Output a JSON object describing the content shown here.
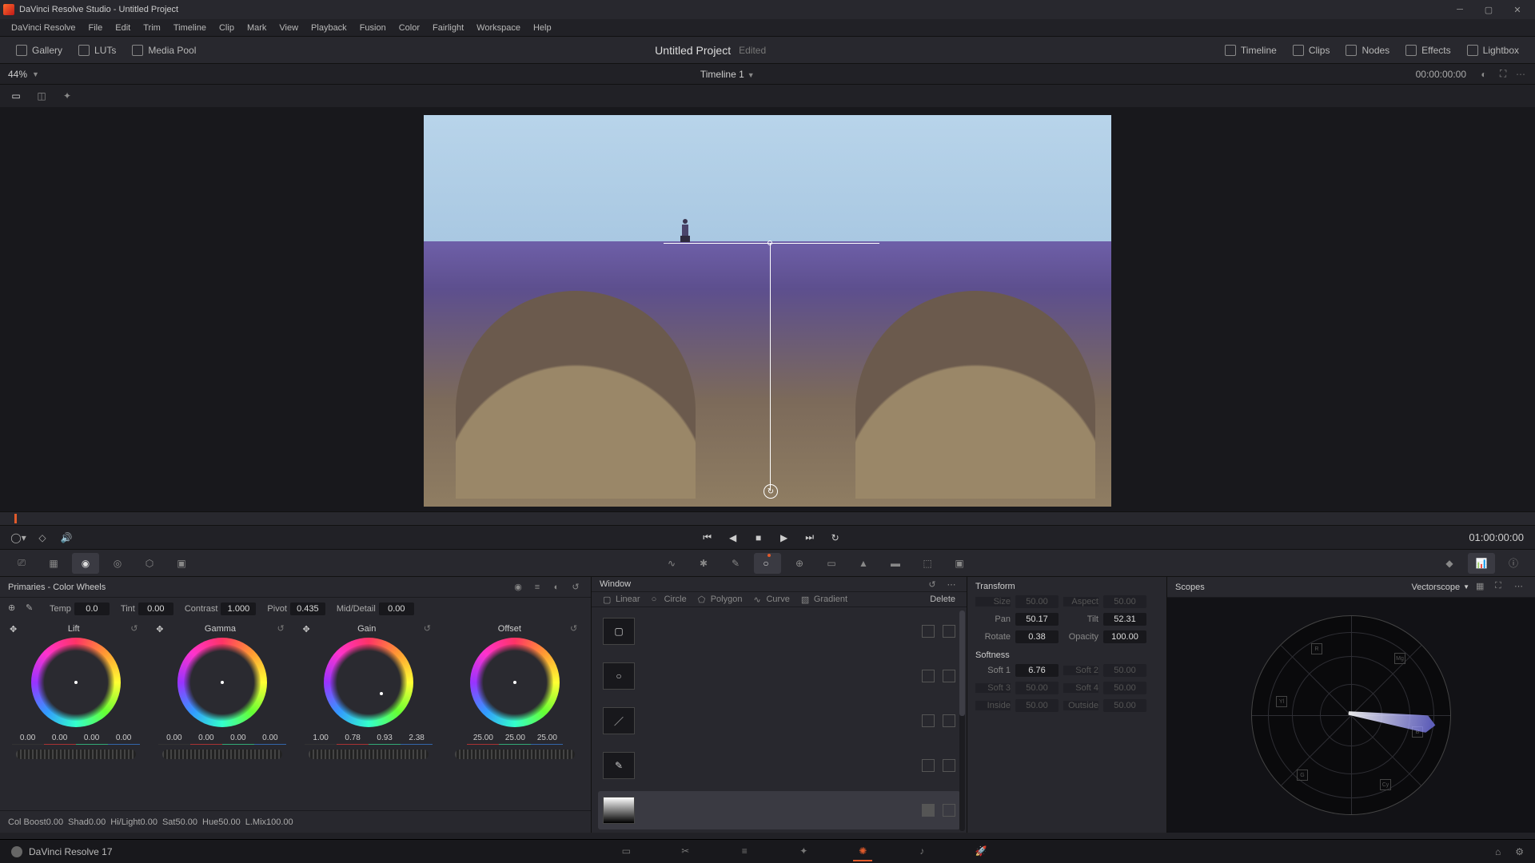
{
  "titlebar": {
    "text": "DaVinci Resolve Studio - Untitled Project"
  },
  "menu": [
    "DaVinci Resolve",
    "File",
    "Edit",
    "Trim",
    "Timeline",
    "Clip",
    "Mark",
    "View",
    "Playback",
    "Fusion",
    "Color",
    "Fairlight",
    "Workspace",
    "Help"
  ],
  "toolbar": {
    "left": [
      {
        "icon": "gallery-icon",
        "label": "Gallery"
      },
      {
        "icon": "luts-icon",
        "label": "LUTs"
      },
      {
        "icon": "media-pool-icon",
        "label": "Media Pool"
      }
    ],
    "project": "Untitled Project",
    "edited": "Edited",
    "right": [
      {
        "icon": "timeline-icon",
        "label": "Timeline"
      },
      {
        "icon": "clips-icon",
        "label": "Clips"
      },
      {
        "icon": "nodes-icon",
        "label": "Nodes"
      },
      {
        "icon": "effects-icon",
        "label": "Effects"
      },
      {
        "icon": "lightbox-icon",
        "label": "Lightbox"
      }
    ]
  },
  "secbar": {
    "zoom": "44%",
    "timeline": "Timeline 1",
    "timecode": "00:00:00:00"
  },
  "transport": {
    "timecode": "01:00:00:00"
  },
  "primaries": {
    "title": "Primaries - Color Wheels",
    "top": {
      "temp_l": "Temp",
      "temp": "0.0",
      "tint_l": "Tint",
      "tint": "0.00",
      "contrast_l": "Contrast",
      "contrast": "1.000",
      "pivot_l": "Pivot",
      "pivot": "0.435",
      "md_l": "Mid/Detail",
      "md": "0.00"
    },
    "wheels": {
      "lift": {
        "label": "Lift",
        "vals": [
          "0.00",
          "0.00",
          "0.00",
          "0.00"
        ]
      },
      "gamma": {
        "label": "Gamma",
        "vals": [
          "0.00",
          "0.00",
          "0.00",
          "0.00"
        ]
      },
      "gain": {
        "label": "Gain",
        "vals": [
          "1.00",
          "0.78",
          "0.93",
          "2.38"
        ]
      },
      "offset": {
        "label": "Offset",
        "vals": [
          "25.00",
          "25.00",
          "25.00"
        ]
      }
    },
    "bottom": {
      "cb_l": "Col Boost",
      "cb": "0.00",
      "shad_l": "Shad",
      "shad": "0.00",
      "hl_l": "Hi/Light",
      "hl": "0.00",
      "sat_l": "Sat",
      "sat": "50.00",
      "hue_l": "Hue",
      "hue": "50.00",
      "lmix_l": "L.Mix",
      "lmix": "100.00"
    }
  },
  "window": {
    "title": "Window",
    "shapes": {
      "linear": "Linear",
      "circle": "Circle",
      "polygon": "Polygon",
      "curve": "Curve",
      "gradient": "Gradient",
      "delete": "Delete"
    }
  },
  "transform": {
    "title": "Transform",
    "size_l": "Size",
    "size": "50.00",
    "aspect_l": "Aspect",
    "aspect": "50.00",
    "pan_l": "Pan",
    "pan": "50.17",
    "tilt_l": "Tilt",
    "tilt": "52.31",
    "rotate_l": "Rotate",
    "rotate": "0.38",
    "opacity_l": "Opacity",
    "opacity": "100.00",
    "soft_title": "Softness",
    "s1_l": "Soft 1",
    "s1": "6.76",
    "s2_l": "Soft 2",
    "s2": "50.00",
    "s3_l": "Soft 3",
    "s3": "50.00",
    "s4_l": "Soft 4",
    "s4": "50.00",
    "in_l": "Inside",
    "in": "50.00",
    "out_l": "Outside",
    "out": "50.00"
  },
  "scopes": {
    "title": "Scopes",
    "mode": "Vectorscope"
  },
  "pagebar": {
    "label": "DaVinci Resolve 17"
  }
}
